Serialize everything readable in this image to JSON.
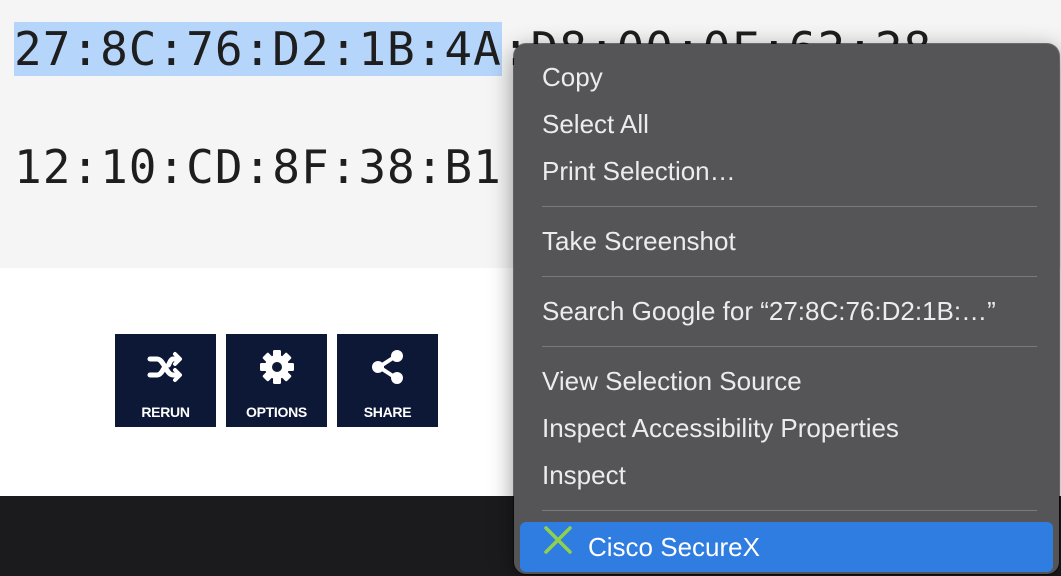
{
  "page": {
    "mac_line1_selected": "27:8C:76:D2:1B:4A",
    "mac_line1_rest": ":D8:00:0F:62:28",
    "mac_line2": "12:10:CD:8F:38:B1"
  },
  "toolbar": {
    "rerun_label": "RERUN",
    "options_label": "OPTIONS",
    "share_label": "SHARE"
  },
  "context_menu": {
    "copy": "Copy",
    "select_all": "Select All",
    "print_selection": "Print Selection…",
    "take_screenshot": "Take Screenshot",
    "search_google": "Search Google for “27:8C:76:D2:1B:…”",
    "view_selection_source": "View Selection Source",
    "inspect_accessibility": "Inspect Accessibility Properties",
    "inspect": "Inspect",
    "cisco_securex": "Cisco SecureX"
  },
  "colors": {
    "selection": "#b5d5fb",
    "button_bg": "#0d1837",
    "menu_bg": "#555558",
    "menu_highlight": "#2f7de1",
    "cisco_icon": "#8fd14f"
  },
  "icons": {
    "rerun": "shuffle-icon",
    "options": "gear-icon",
    "share": "share-icon",
    "cisco": "cisco-securex-icon"
  }
}
